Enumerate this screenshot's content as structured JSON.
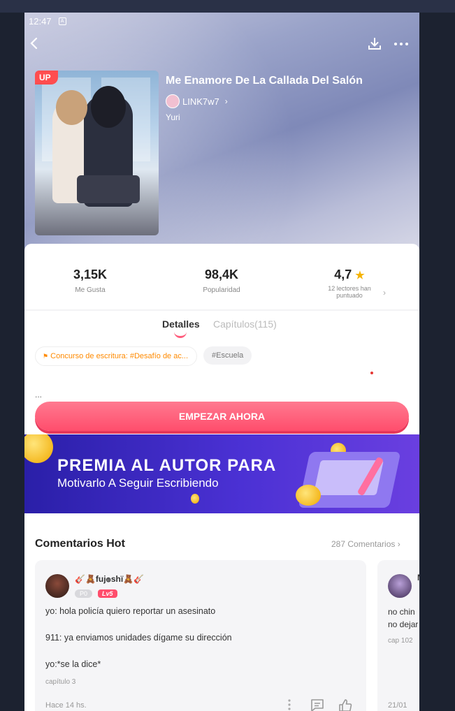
{
  "status_bar": {
    "time": "12:47",
    "indicator": "A"
  },
  "book": {
    "badge": "UP",
    "title": "Me Enamore De La Callada Del Salón",
    "author": "LINK7w7",
    "genre": "Yuri"
  },
  "stats": {
    "likes": {
      "value": "3,15K",
      "label": "Me Gusta"
    },
    "popularity": {
      "value": "98,4K",
      "label": "Popularidad"
    },
    "rating": {
      "value": "4,7",
      "label_line1": "12 lectores han",
      "label_line2": "puntuado"
    }
  },
  "tabs": {
    "details": "Detalles",
    "chapters": "Capítulos(115)"
  },
  "tags": {
    "contest": "Concurso de escritura: #Desafío de ac...",
    "school": "#Escuela"
  },
  "description": "...",
  "start_button": "EMPEZAR AHORA",
  "banner": {
    "line1": "PREMIA AL AUTOR PARA",
    "line2": "Motivarlo A Seguir Escribiendo"
  },
  "comments": {
    "header": "Comentarios Hot",
    "count": "287 Comentarios",
    "items": [
      {
        "user": "🎸🧸fuj๏ѕhï🧸🎸",
        "badge_p": "P0",
        "badge_lv": "Lv5",
        "lines": [
          "yo: hola policía quiero reportar un asesinato",
          "911: ya enviamos unidades dígame su dirección",
          "yo:*se la dice*"
        ],
        "chapter": "capítulo 3",
        "time": "Hace 14 hs."
      },
      {
        "user": "N",
        "lines": [
          "no chin",
          "no dejar"
        ],
        "chapter": "cap 102",
        "time": "21/01"
      }
    ]
  },
  "colors": {
    "accent": "#ff4d6c",
    "banner": "#4b31d4",
    "star": "#f5b300"
  }
}
